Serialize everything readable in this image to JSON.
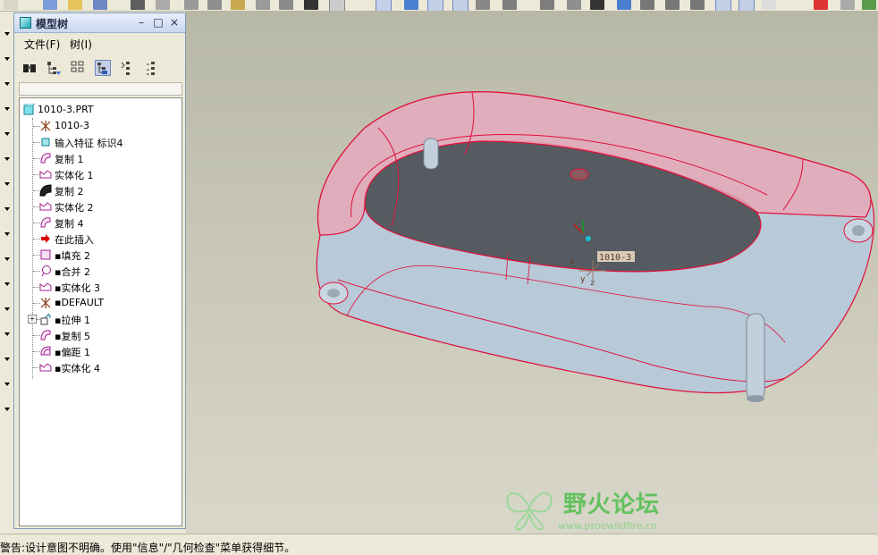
{
  "tree_panel": {
    "title": "模型树",
    "minimize_glyph": "–",
    "restore_glyph": "□",
    "close_glyph": "×",
    "menus": [
      {
        "label": "文件(F)"
      },
      {
        "label": "树(I)"
      }
    ],
    "tools": [
      {
        "icon": "binoculars-icon"
      },
      {
        "icon": "tree-filter-icon"
      },
      {
        "icon": "tree-columns-icon"
      },
      {
        "icon": "show-tree-icon",
        "active": true
      },
      {
        "icon": "expand-tree-icon"
      },
      {
        "icon": "collapse-tree-icon"
      }
    ],
    "items": [
      {
        "label": "1010-3.PRT",
        "icon": "part-icon",
        "indent": 0
      },
      {
        "label": "1010-3",
        "icon": "csys-icon",
        "indent": 1
      },
      {
        "label": "输入特征 标识4",
        "icon": "import-feature-icon",
        "indent": 1
      },
      {
        "label": "复制 1",
        "icon": "copy-icon",
        "indent": 1
      },
      {
        "label": "实体化 1",
        "icon": "solidify-icon",
        "indent": 1
      },
      {
        "label": "复制 2",
        "icon": "copy-dark-icon",
        "indent": 1
      },
      {
        "label": "实体化 2",
        "icon": "solidify-icon",
        "indent": 1
      },
      {
        "label": "复制 4",
        "icon": "copy-icon",
        "indent": 1
      },
      {
        "label": "在此插入",
        "icon": "insert-here-arrow-icon",
        "indent": 1
      },
      {
        "label": "▪填充 2",
        "icon": "fill-icon",
        "indent": 1
      },
      {
        "label": "▪合并 2",
        "icon": "merge-icon",
        "indent": 1
      },
      {
        "label": "▪实体化 3",
        "icon": "solidify-icon",
        "indent": 1
      },
      {
        "label": "▪DEFAULT",
        "icon": "csys-icon",
        "indent": 1
      },
      {
        "label": "▪拉伸 1",
        "icon": "extrude-icon",
        "indent": 1,
        "expandable": true,
        "expand_glyph": "+"
      },
      {
        "label": "▪复制 5",
        "icon": "copy-icon",
        "indent": 1
      },
      {
        "label": "▪偏距 1",
        "icon": "offset-icon",
        "indent": 1
      },
      {
        "label": "▪实体化 4",
        "icon": "solidify-icon",
        "indent": 1
      }
    ]
  },
  "viewport": {
    "csys_label": "1010-3",
    "axis_labels": {
      "x": "x",
      "y": "y",
      "z": "z"
    }
  },
  "status": {
    "message": "警告:设计意图不明确。使用\"信息\"/\"几何检查\"菜单获得细节。"
  },
  "watermark": {
    "title": "野火论坛",
    "url": "www.proewildfire.cn"
  },
  "colors": {
    "edge_red": "#e0103a",
    "shell_pink": "#e6a8b8",
    "body_blue": "#b8c9d8",
    "cavity_gray": "#555b60",
    "accent_green": "#63c25f"
  }
}
